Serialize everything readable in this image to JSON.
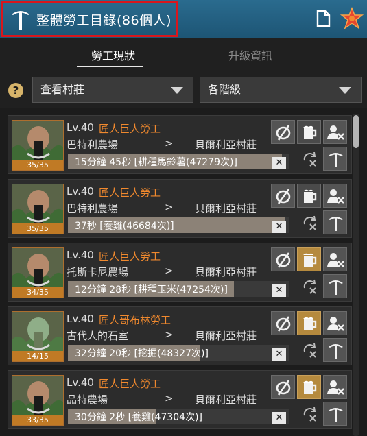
{
  "header": {
    "title": "整體勞工目錄(86個人)",
    "icons": {
      "logo": "pickaxe-icon",
      "doc": "document-icon",
      "star": "star-icon"
    },
    "highlight_color": "#d9161c"
  },
  "tabs": [
    {
      "label": "勞工現狀",
      "active": true
    },
    {
      "label": "升級資訊",
      "active": false
    }
  ],
  "filters": {
    "help_label": "?",
    "village": "查看村莊",
    "level": "各階級"
  },
  "workers": [
    {
      "count": "35/35",
      "level": "Lv.40",
      "job": "匠人巨人勞工",
      "from": "巴特利農場",
      "arrow": ">",
      "to": "貝爾利亞村莊",
      "task": "15分鐘 45秒 [耕種馬鈴薯(47279次)]",
      "progress": 0.97,
      "stamina_active": false,
      "portrait": "giant"
    },
    {
      "count": "35/35",
      "level": "Lv.40",
      "job": "匠人巨人勞工",
      "from": "巴特利農場",
      "arrow": ">",
      "to": "貝爾利亞村莊",
      "task": "37秒 [養雞(46684次)]",
      "progress": 0.98,
      "stamina_active": false,
      "portrait": "giant"
    },
    {
      "count": "34/35",
      "level": "Lv.40",
      "job": "匠人巨人勞工",
      "from": "托斯卡尼農場",
      "arrow": ">",
      "to": "貝爾利亞村莊",
      "task": "12分鐘 28秒 [耕種玉米(47254次)]",
      "progress": 0.75,
      "stamina_active": true,
      "portrait": "giant"
    },
    {
      "count": "14/15",
      "level": "Lv.40",
      "job": "匠人哥布林勞工",
      "from": "古代人的石室",
      "arrow": ">",
      "to": "貝爾利亞村莊",
      "task": "32分鐘 20秒 [挖掘(48327次)]",
      "progress": 0.6,
      "stamina_active": true,
      "portrait": "goblin"
    },
    {
      "count": "33/35",
      "level": "Lv.40",
      "job": "匠人巨人勞工",
      "from": "品特農場",
      "arrow": ">",
      "to": "貝爾利亞村莊",
      "task": "30分鐘 2秒 [養雞(47304次)]",
      "progress": 0.4,
      "stamina_active": true,
      "portrait": "giant"
    }
  ],
  "row_actions": {
    "icons": [
      "hide-icon",
      "beer-icon",
      "fire-worker-icon",
      "repeat-icon",
      "pickaxe-icon"
    ],
    "cancel_label": "✕"
  },
  "colors": {
    "job": "#f0892e",
    "count_bg": "#c07a25",
    "header": "#2a6b8e"
  }
}
